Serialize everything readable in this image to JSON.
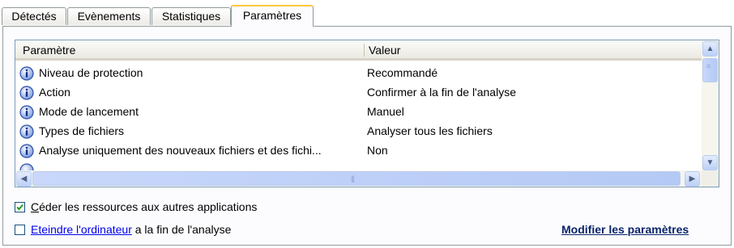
{
  "tabs": [
    {
      "label": "Détectés"
    },
    {
      "label": "Evènements"
    },
    {
      "label": "Statistiques"
    },
    {
      "label": "Paramètres",
      "active": true
    }
  ],
  "table": {
    "columns": [
      "Paramètre",
      "Valeur"
    ],
    "rows": [
      {
        "param": "Niveau de protection",
        "value": "Recommandé"
      },
      {
        "param": "Action",
        "value": "Confirmer à la fin de l'analyse"
      },
      {
        "param": "Mode de lancement",
        "value": "Manuel"
      },
      {
        "param": "Types de fichiers",
        "value": "Analyser tous les fichiers"
      },
      {
        "param": "Analyse uniquement des nouveaux fichiers et des fichi...",
        "value": "Non"
      }
    ],
    "row_icon": "info-icon"
  },
  "options": {
    "yield_resources": {
      "label": "éder les ressources aux autres applications",
      "mnemonic": "C",
      "checked": true
    },
    "shutdown": {
      "link_text": "Eteindre l'ordinateur",
      "label_rest": " a la fin de l'analyse",
      "checked": false
    }
  },
  "modify_link": "Modifier les paramètres",
  "colors": {
    "active_tab_accent": "#ffc83c",
    "link": "#0000ee",
    "modify_link": "#0a246a"
  }
}
